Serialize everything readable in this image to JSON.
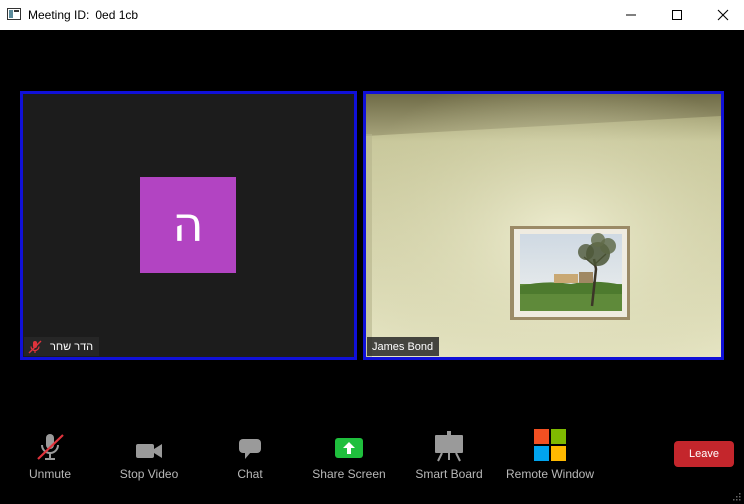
{
  "window": {
    "title_label": "Meeting ID:",
    "meeting_id": "0ed 1cb",
    "controls": [
      "minimize",
      "maximize",
      "close"
    ]
  },
  "participants": [
    {
      "name": "הדר שחר",
      "avatar_letter": "ה",
      "avatar_color": "#b244c2",
      "muted": true,
      "video": "off"
    },
    {
      "name": "James Bond",
      "muted": false,
      "video": "on"
    }
  ],
  "toolbar": {
    "unmute": "Unmute",
    "stop_video": "Stop Video",
    "chat": "Chat",
    "share_screen": "Share Screen",
    "smart_board": "Smart Board",
    "remote_window": "Remote Window",
    "leave": "Leave"
  },
  "colors": {
    "active_speaker_border": "#1010d8",
    "share_screen": "#1fbf3d",
    "leave": "#c4262c",
    "muted_slash": "#e0333c"
  }
}
